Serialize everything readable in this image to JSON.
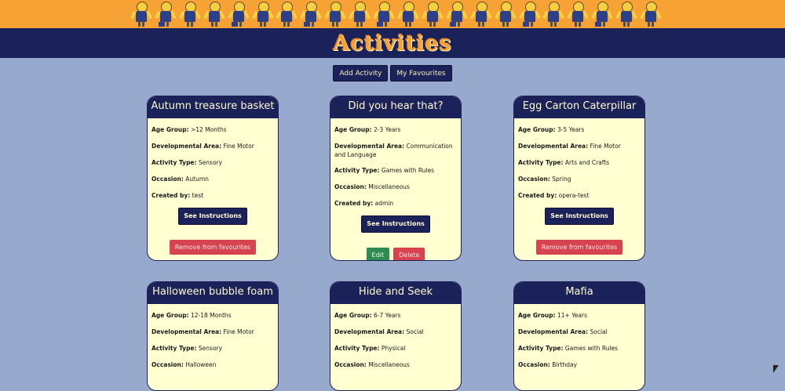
{
  "banner": {
    "figure_count": 22
  },
  "header": {
    "title": "Activities"
  },
  "actions": {
    "add_label": "Add Activity",
    "favourites_label": "My Favourites"
  },
  "labels": {
    "age": "Age Group:",
    "dev": "Developmental Area:",
    "type": "Activity Type:",
    "occasion": "Occasion:",
    "created": "Created by:",
    "instructions": "See Instructions",
    "remove": "Remove from favourites",
    "edit": "Edit",
    "delete": "Delete"
  },
  "cards": [
    {
      "title": "Autumn treasure basket",
      "age": ">12 Months",
      "dev": "Fine Motor",
      "type": "Sensory",
      "occasion": "Autumn",
      "created": "test"
    },
    {
      "title": "Did you hear that?",
      "age": "2-3 Years",
      "dev": "Communication and Language",
      "type": "Games with Rules",
      "occasion": "Miscellaneous",
      "created": "admin"
    },
    {
      "title": "Egg Carton Caterpillar",
      "age": "3-5 Years",
      "dev": "Fine Motor",
      "type": "Arts and Crafts",
      "occasion": "Spring",
      "created": "opera-test"
    },
    {
      "title": "Halloween bubble foam",
      "age": "12-18 Months",
      "dev": "Fine Motor",
      "type": "Sensory",
      "occasion": "Halloween"
    },
    {
      "title": "Hide and Seek",
      "age": "6-7 Years",
      "dev": "Social",
      "type": "Physical",
      "occasion": "Miscellaneous"
    },
    {
      "title": "Mafia",
      "age": "11+ Years",
      "dev": "Social",
      "type": "Games with Rules",
      "occasion": "Birthday"
    }
  ],
  "colors": {
    "page_bg": "#97a9cc",
    "navy": "#1b2159",
    "orange": "#f6a234",
    "card_bg": "#ffffd2",
    "danger": "#d84350",
    "success": "#2e8b52"
  }
}
